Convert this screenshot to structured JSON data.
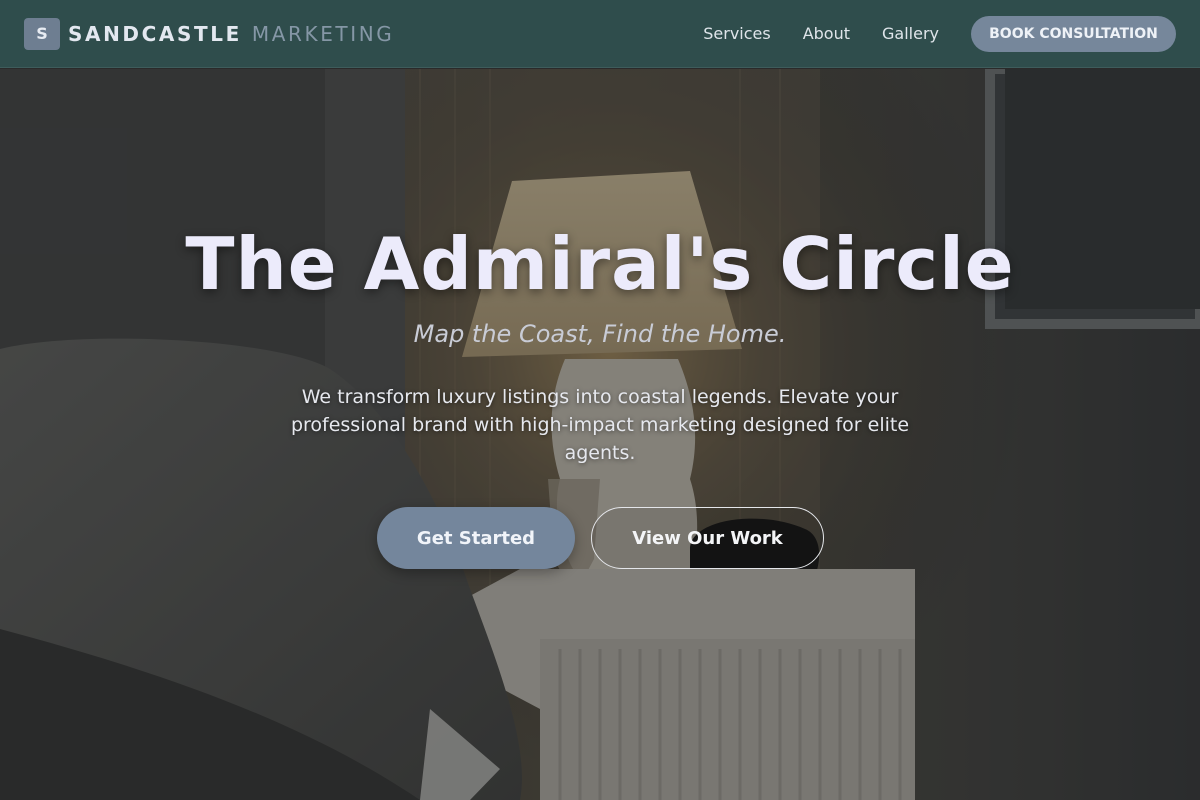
{
  "header": {
    "logo_initial": "S",
    "brand_primary": "SANDCASTLE",
    "brand_secondary": "MARKETING",
    "nav": [
      {
        "label": "Services"
      },
      {
        "label": "About"
      },
      {
        "label": "Gallery"
      }
    ],
    "cta_label": "BOOK CONSULTATION"
  },
  "hero": {
    "title": "The Admiral's Circle",
    "subtitle": "Map the Coast, Find the Home.",
    "description": "We transform luxury listings into coastal legends. Elevate your professional brand with high-impact marketing designed for elite agents.",
    "primary_button": "Get Started",
    "secondary_button": "View Our Work"
  },
  "colors": {
    "header_bg": "#2f4d4c",
    "accent": "#76879b",
    "title_text": "#ecebfb"
  }
}
